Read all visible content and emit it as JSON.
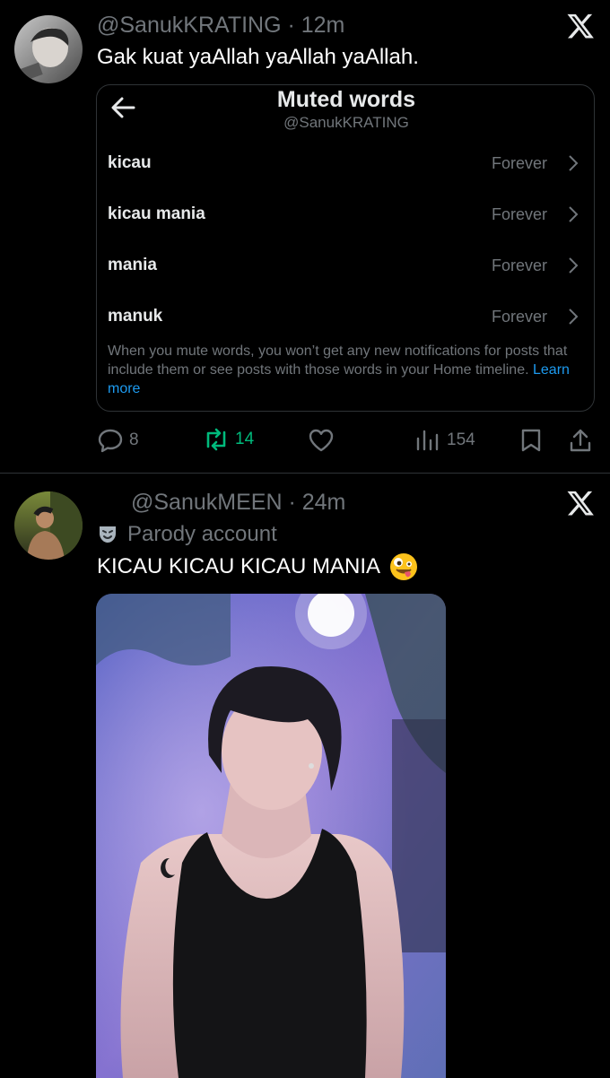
{
  "post1": {
    "handle": "@SanukKRATING",
    "time": "12m",
    "text": "Gak kuat yaAllah yaAllah yaAllah.",
    "card": {
      "title": "Muted words",
      "subtitle": "@SanukKRATING",
      "rows": [
        {
          "word": "kicau",
          "duration": "Forever"
        },
        {
          "word": "kicau mania",
          "duration": "Forever"
        },
        {
          "word": "mania",
          "duration": "Forever"
        },
        {
          "word": "manuk",
          "duration": "Forever"
        }
      ],
      "note": "When you mute words, you won’t get any new notifications for posts that include them or see posts with those words in your Home timeline.",
      "learn_more": "Learn more"
    },
    "actions": {
      "replies": "8",
      "reposts": "14",
      "views": "154"
    }
  },
  "post2": {
    "handle": "@SanukMEEN",
    "time": "24m",
    "badge": "Parody account",
    "text": "KICAU KICAU KICAU MANIA",
    "emoji": "zany-face"
  },
  "colors": {
    "background": "#000000",
    "muted": "#71767b",
    "repost": "#00ba7c",
    "link": "#1d9bf0",
    "border": "#2f3336"
  }
}
